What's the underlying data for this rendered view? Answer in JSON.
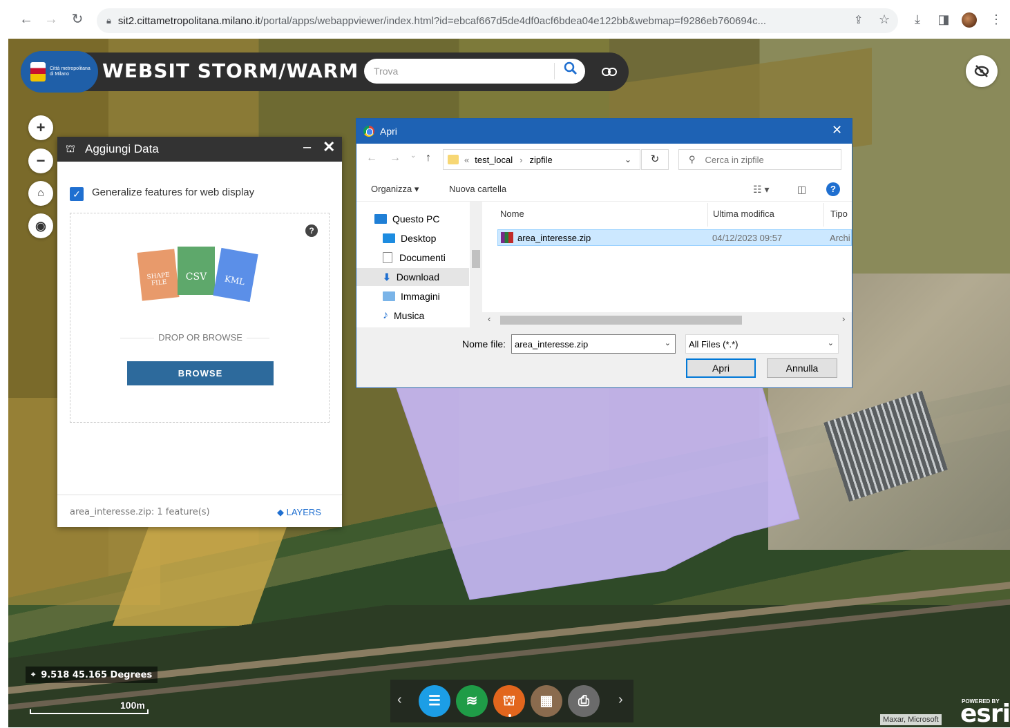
{
  "browser": {
    "url_host": "sit2.cittametropolitana.milano.it",
    "url_path": "/portal/apps/webappviewer/index.html?id=ebcaf667d5de4df0acf6bdea04e122bb&webmap=f9286eb760694c..."
  },
  "app": {
    "logo_text": "Città metropolitana di Milano",
    "title": "WEBSIT STORM/WARM",
    "search_placeholder": "Trova"
  },
  "add_data": {
    "title": "Aggiungi Data",
    "generalize_label": "Generalize features for web display",
    "generalize_checked": true,
    "file_types": [
      "SHAPE FILE",
      "CSV",
      "KML"
    ],
    "drop_text": "DROP OR BROWSE",
    "browse_label": "BROWSE",
    "status": "area_interesse.zip: 1 feature(s)",
    "layers_label": "LAYERS"
  },
  "dialog": {
    "title": "Apri",
    "path": [
      "test_local",
      "zipfile"
    ],
    "path_prefix": "«",
    "search_placeholder": "Cerca in zipfile",
    "toolbar": {
      "organize": "Organizza",
      "new_folder": "Nuova cartella"
    },
    "tree": [
      "Questo PC",
      "Desktop",
      "Documenti",
      "Download",
      "Immagini",
      "Musica"
    ],
    "tree_active": "Download",
    "columns": [
      "Nome",
      "Ultima modifica",
      "Tipo"
    ],
    "files": [
      {
        "name": "area_interesse.zip",
        "modified": "04/12/2023 09:57",
        "type": "Archi"
      }
    ],
    "filename_label": "Nome file:",
    "filename_value": "area_interesse.zip",
    "filter_value": "All Files (*.*)",
    "open_label": "Apri",
    "cancel_label": "Annulla"
  },
  "map": {
    "coordinates": "9.518 45.165 Degrees",
    "scale_label": "100m",
    "attribution": "Maxar, Microsoft",
    "esri_powered": "POWERED BY",
    "esri_logo": "esri",
    "area_color": "#c6b6f3"
  },
  "colors": {
    "header_bg": "#2f2f2f",
    "logo_bg": "#1f5fa8",
    "browse_btn": "#2d6a9c",
    "dialog_title": "#1e62b4",
    "list_btn": "#1c9ee6",
    "layers_btn": "#1f9c47",
    "add_data_btn": "#e2661d",
    "basemap_btn": "#8a6b4e",
    "print_btn": "#6b6b6b"
  }
}
